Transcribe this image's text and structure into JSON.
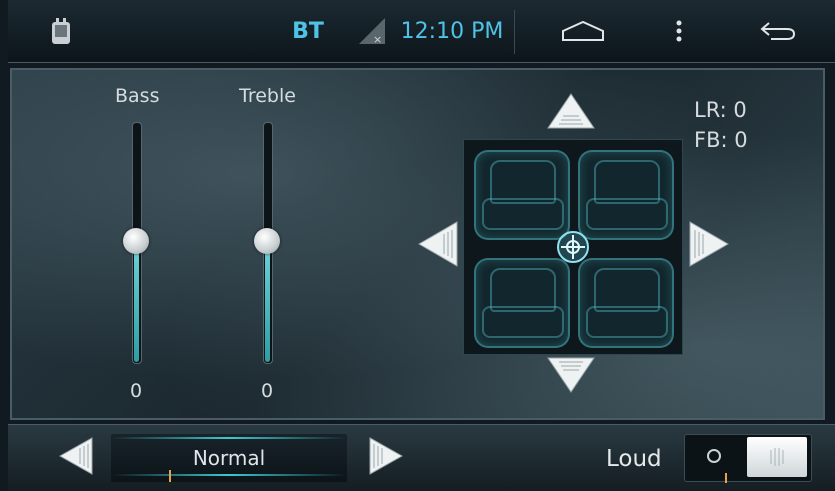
{
  "status_bar": {
    "bt_label": "BT",
    "time": "12:10 PM",
    "icons": [
      "android-icon",
      "signal-icon",
      "home-icon",
      "menu-icon",
      "back-icon"
    ]
  },
  "tone": {
    "bass_label": "Bass",
    "bass_value": "0",
    "treble_label": "Treble",
    "treble_value": "0"
  },
  "balance": {
    "lr_text": "LR: 0",
    "fb_text": "FB: 0"
  },
  "bottom": {
    "preset": "Normal",
    "loud_label": "Loud"
  },
  "colors": {
    "accent": "#3fc8d0",
    "status_text": "#4fc3e6"
  }
}
